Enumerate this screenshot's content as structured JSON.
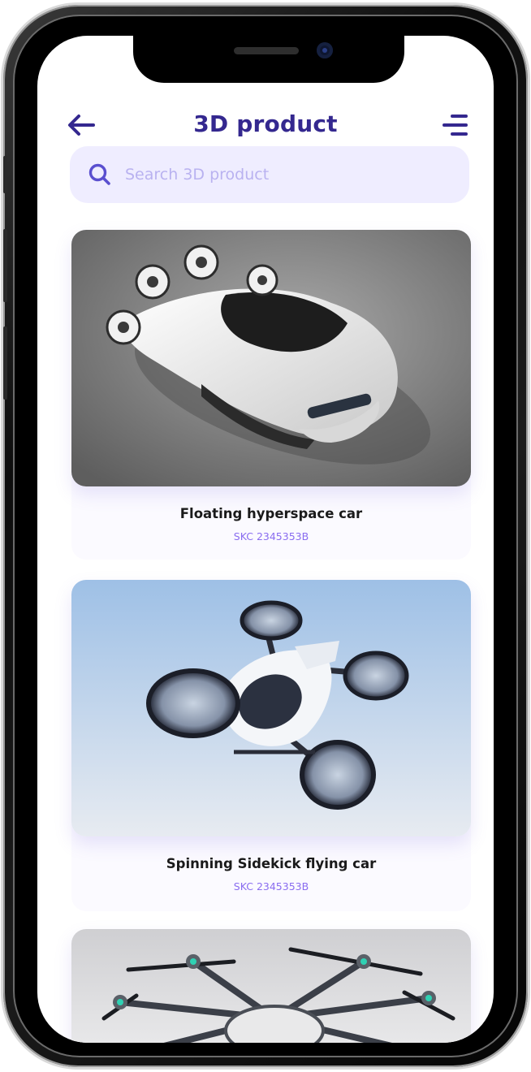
{
  "header": {
    "title": "3D product",
    "back_icon": "arrow-left-icon",
    "menu_icon": "menu-lines-icon"
  },
  "search": {
    "placeholder": "Search 3D product",
    "value": "",
    "icon": "search-icon"
  },
  "products": [
    {
      "name": "Floating hyperspace car",
      "sku": "SKC 2345353B",
      "image": "white hover car with four rotor pods on grey floor"
    },
    {
      "name": "Spinning Sidekick flying car",
      "sku": "SKC 2345353B",
      "image": "white quad-rotor flying car against blue sky"
    },
    {
      "name": "",
      "sku": "",
      "image": "multi-rotor drone craft with black propellers"
    }
  ],
  "colors": {
    "accent": "#34288f",
    "search_bg": "#efedff",
    "sku": "#8a6df0",
    "placeholder": "#b9b2f0"
  }
}
